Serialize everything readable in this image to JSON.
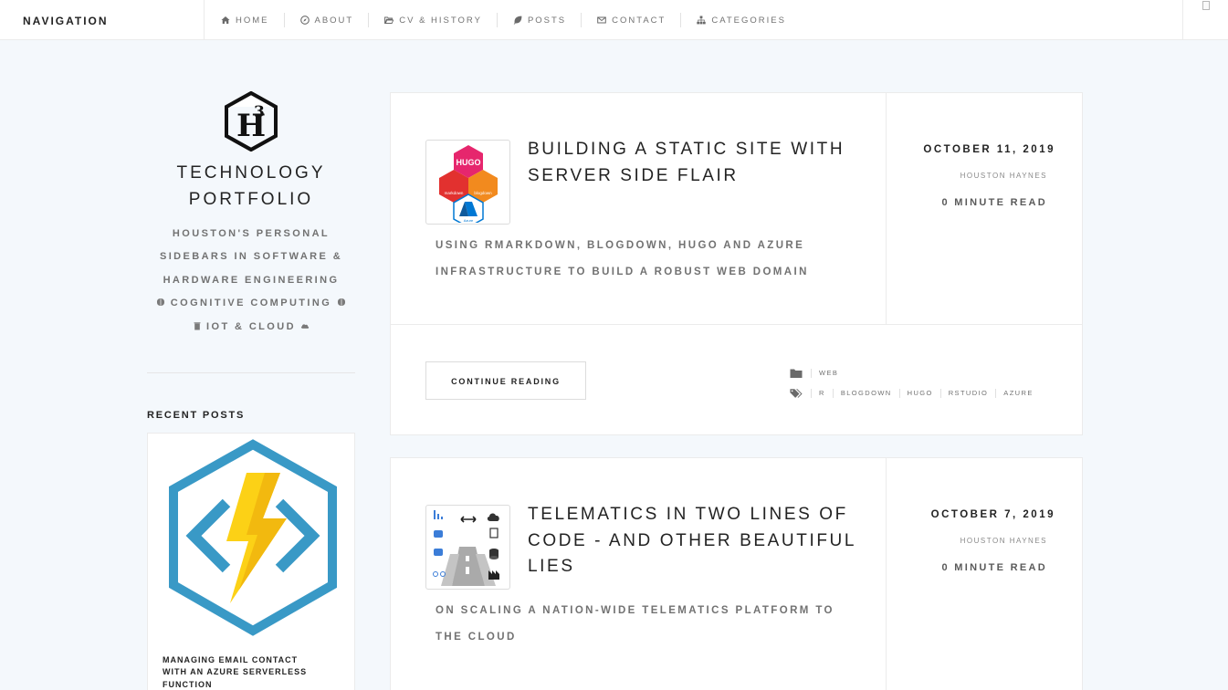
{
  "nav": {
    "brand": "NAVIGATION",
    "items": [
      {
        "label": "HOME",
        "icon": "home-icon"
      },
      {
        "label": "ABOUT",
        "icon": "compass-icon"
      },
      {
        "label": "CV & HISTORY",
        "icon": "folder-open-icon"
      },
      {
        "label": "POSTS",
        "icon": "leaf-icon"
      },
      {
        "label": "CONTACT",
        "icon": "envelope-icon"
      },
      {
        "label": "CATEGORIES",
        "icon": "sitemap-icon"
      }
    ]
  },
  "sidebar": {
    "title_line1": "TECHNOLOGY",
    "title_line2": "PORTFOLIO",
    "tagline": [
      "HOUSTON'S PERSONAL",
      "SIDEBARS IN SOFTWARE &",
      "HARDWARE ENGINEERING"
    ],
    "tag_cognitive": "COGNITIVE COMPUTING",
    "tag_iot": "IOT & CLOUD",
    "recent_title": "RECENT POSTS",
    "recent_post_title": "MANAGING EMAIL CONTACT WITH AN AZURE SERVERLESS FUNCTION"
  },
  "posts": [
    {
      "title": "BUILDING A STATIC SITE WITH SERVER SIDE FLAIR",
      "summary": "USING RMARKDOWN, BLOGDOWN, HUGO AND AZURE INFRASTRUCTURE TO BUILD A ROBUST WEB DOMAIN",
      "date": "OCTOBER 11, 2019",
      "author": "HOUSTON HAYNES",
      "read_time": "0 MINUTE READ",
      "continue_label": "CONTINUE READING",
      "categories": [
        "WEB"
      ],
      "tags": [
        "R",
        "BLOGDOWN",
        "HUGO",
        "RSTUDIO",
        "AZURE"
      ]
    },
    {
      "title": "TELEMATICS IN TWO LINES OF CODE - AND OTHER BEAUTIFUL LIES",
      "summary": "ON SCALING A NATION-WIDE TELEMATICS PLATFORM TO THE CLOUD",
      "date": "OCTOBER 7, 2019",
      "author": "HOUSTON HAYNES",
      "read_time": "0 MINUTE READ"
    }
  ],
  "thumb_badges": {
    "hugo": "HUGO",
    "markdown": "markdown",
    "blogdown": "blogdown",
    "azure": "Azure"
  },
  "colors": {
    "page_bg": "#f4f8fc",
    "accent_dark": "#232323",
    "muted": "#727272",
    "hugo_pink": "#e6266d",
    "markdown_red": "#e2312f",
    "blogdown_orange": "#f28a1e",
    "azure_blue": "#0078d4",
    "functions_blue": "#3999c6",
    "functions_yellow": "#fcd116"
  }
}
